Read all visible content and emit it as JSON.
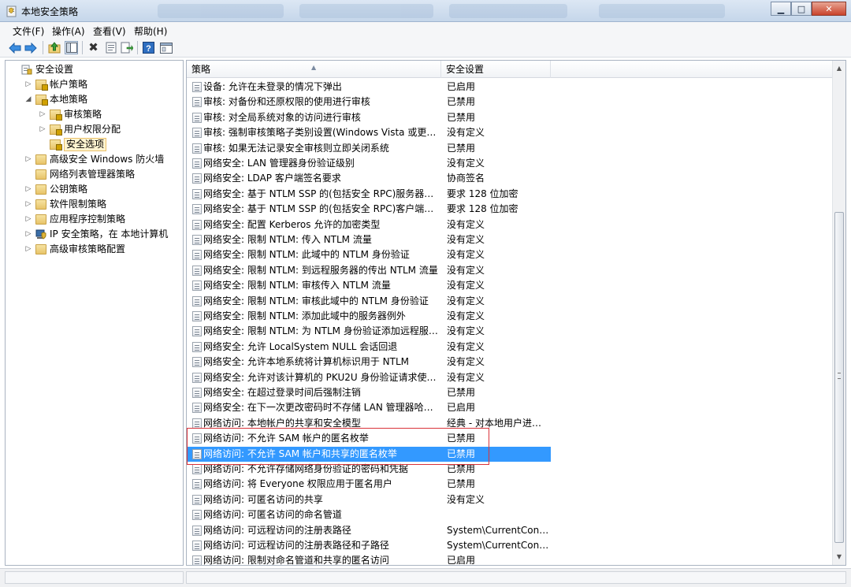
{
  "window": {
    "title": "本地安全策略"
  },
  "menu": [
    {
      "label": "文件(F)"
    },
    {
      "label": "操作(A)"
    },
    {
      "label": "查看(V)"
    },
    {
      "label": "帮助(H)"
    }
  ],
  "toolbar": {
    "buttons": [
      {
        "icon": "back-arrow-icon"
      },
      {
        "icon": "forward-arrow-icon"
      },
      {
        "icon": "up-folder-icon"
      },
      {
        "icon": "show-hide-tree-icon"
      },
      {
        "icon": "delete-icon"
      },
      {
        "icon": "properties-icon"
      },
      {
        "icon": "export-list-icon"
      },
      {
        "icon": "help-icon"
      },
      {
        "icon": "mmc-view-icon"
      }
    ]
  },
  "tree": [
    {
      "label": "安全设置",
      "level": 0,
      "arrow": "",
      "icon": "security-settings-icon"
    },
    {
      "label": "帐户策略",
      "level": 1,
      "arrow": "▷",
      "icon": "folder-lock-icon"
    },
    {
      "label": "本地策略",
      "level": 1,
      "arrow": "◢",
      "icon": "folder-lock-icon"
    },
    {
      "label": "审核策略",
      "level": 2,
      "arrow": "▷",
      "icon": "folder-lock-icon"
    },
    {
      "label": "用户权限分配",
      "level": 2,
      "arrow": "▷",
      "icon": "folder-lock-icon"
    },
    {
      "label": "安全选项",
      "level": 2,
      "arrow": "",
      "icon": "folder-lock-icon",
      "selected": true
    },
    {
      "label": "高级安全 Windows 防火墙",
      "level": 1,
      "arrow": "▷",
      "icon": "folder-icon"
    },
    {
      "label": "网络列表管理器策略",
      "level": 1,
      "arrow": "",
      "icon": "folder-icon"
    },
    {
      "label": "公钥策略",
      "level": 1,
      "arrow": "▷",
      "icon": "folder-icon"
    },
    {
      "label": "软件限制策略",
      "level": 1,
      "arrow": "▷",
      "icon": "folder-icon"
    },
    {
      "label": "应用程序控制策略",
      "level": 1,
      "arrow": "▷",
      "icon": "folder-icon"
    },
    {
      "label": "IP 安全策略，在 本地计算机",
      "level": 1,
      "arrow": "▷",
      "icon": "ip-security-icon"
    },
    {
      "label": "高级审核策略配置",
      "level": 1,
      "arrow": "▷",
      "icon": "folder-icon"
    }
  ],
  "list": {
    "columns": [
      "策略",
      "安全设置"
    ],
    "rows": [
      {
        "policy": "设备: 允许在未登录的情况下弹出",
        "setting": "已启用"
      },
      {
        "policy": "审核: 对备份和还原权限的使用进行审核",
        "setting": "已禁用"
      },
      {
        "policy": "审核: 对全局系统对象的访问进行审核",
        "setting": "已禁用"
      },
      {
        "policy": "审核: 强制审核策略子类别设置(Windows Vista 或更高版本...",
        "setting": "没有定义"
      },
      {
        "policy": "审核: 如果无法记录安全审核则立即关闭系统",
        "setting": "已禁用"
      },
      {
        "policy": "网络安全: LAN 管理器身份验证级别",
        "setting": "没有定义"
      },
      {
        "policy": "网络安全: LDAP 客户端签名要求",
        "setting": "协商签名"
      },
      {
        "policy": "网络安全: 基于 NTLM SSP 的(包括安全 RPC)服务器的最小...",
        "setting": "要求 128 位加密"
      },
      {
        "policy": "网络安全: 基于 NTLM SSP 的(包括安全 RPC)客户端的最小...",
        "setting": "要求 128 位加密"
      },
      {
        "policy": "网络安全: 配置 Kerberos 允许的加密类型",
        "setting": "没有定义"
      },
      {
        "policy": "网络安全: 限制 NTLM: 传入 NTLM 流量",
        "setting": "没有定义"
      },
      {
        "policy": "网络安全: 限制 NTLM: 此域中的 NTLM 身份验证",
        "setting": "没有定义"
      },
      {
        "policy": "网络安全: 限制 NTLM: 到远程服务器的传出 NTLM 流量",
        "setting": "没有定义"
      },
      {
        "policy": "网络安全: 限制 NTLM: 审核传入 NTLM 流量",
        "setting": "没有定义"
      },
      {
        "policy": "网络安全: 限制 NTLM: 审核此域中的 NTLM 身份验证",
        "setting": "没有定义"
      },
      {
        "policy": "网络安全: 限制 NTLM: 添加此域中的服务器例外",
        "setting": "没有定义"
      },
      {
        "policy": "网络安全: 限制 NTLM: 为 NTLM 身份验证添加远程服务器...",
        "setting": "没有定义"
      },
      {
        "policy": "网络安全: 允许 LocalSystem NULL 会话回退",
        "setting": "没有定义"
      },
      {
        "policy": "网络安全: 允许本地系统将计算机标识用于 NTLM",
        "setting": "没有定义"
      },
      {
        "policy": "网络安全: 允许对该计算机的 PKU2U 身份验证请求使用联...",
        "setting": "没有定义"
      },
      {
        "policy": "网络安全: 在超过登录时间后强制注销",
        "setting": "已禁用"
      },
      {
        "policy": "网络安全: 在下一次更改密码时不存储 LAN 管理器哈希值",
        "setting": "已启用"
      },
      {
        "policy": "网络访问: 本地帐户的共享和安全模型",
        "setting": "经典 - 对本地用户进行..."
      },
      {
        "policy": "网络访问: 不允许 SAM 帐户的匿名枚举",
        "setting": "已禁用"
      },
      {
        "policy": "网络访问: 不允许 SAM 帐户和共享的匿名枚举",
        "setting": "已禁用",
        "selected": true
      },
      {
        "policy": "网络访问: 不允许存储网络身份验证的密码和凭据",
        "setting": "已禁用"
      },
      {
        "policy": "网络访问: 将 Everyone 权限应用于匿名用户",
        "setting": "已禁用"
      },
      {
        "policy": "网络访问: 可匿名访问的共享",
        "setting": "没有定义"
      },
      {
        "policy": "网络访问: 可匿名访问的命名管道",
        "setting": ""
      },
      {
        "policy": "网络访问: 可远程访问的注册表路径",
        "setting": "System\\CurrentContro..."
      },
      {
        "policy": "网络访问: 可远程访问的注册表路径和子路径",
        "setting": "System\\CurrentContro..."
      },
      {
        "policy": "网络访问: 限制对命名管道和共享的匿名访问",
        "setting": "已启用"
      }
    ]
  },
  "colors": {
    "selection": "#3399ff",
    "highlight_border": "#d9333a",
    "tree_selection_bg": "#fff4d0"
  }
}
